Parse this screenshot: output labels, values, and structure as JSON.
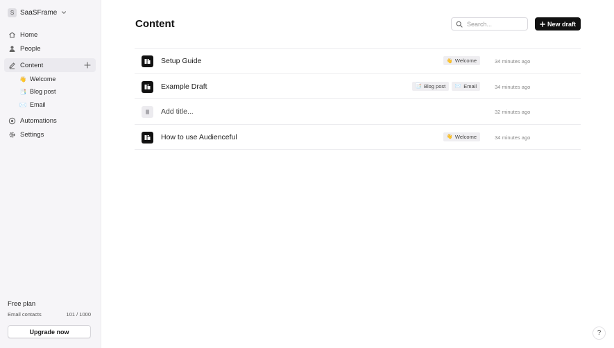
{
  "workspace": {
    "avatar_letter": "S",
    "name": "SaaSFrame"
  },
  "nav": {
    "home": "Home",
    "people": "People",
    "content": "Content",
    "automations": "Automations",
    "settings": "Settings"
  },
  "content_sub": [
    {
      "emoji": "👋",
      "label": "Welcome"
    },
    {
      "emoji": "📑",
      "label": "Blog post"
    },
    {
      "emoji": "✉️",
      "label": "Email"
    }
  ],
  "plan": {
    "title": "Free plan",
    "contacts_label": "Email contacts",
    "contacts_value": "101 / 1000",
    "upgrade_label": "Upgrade now"
  },
  "main": {
    "title": "Content",
    "search_placeholder": "Search...",
    "new_draft_label": "New draft"
  },
  "rows": [
    {
      "title": "Setup Guide",
      "tags": [
        {
          "emoji": "👋",
          "label": "Welcome"
        }
      ],
      "time": "34 minutes ago"
    },
    {
      "title": "Example Draft",
      "tags": [
        {
          "emoji": "📑",
          "label": "Blog post"
        },
        {
          "emoji": "✉️",
          "label": "Email"
        }
      ],
      "time": "34 minutes ago"
    },
    {
      "title": "Add title...",
      "tags": [],
      "time": "32 minutes ago"
    },
    {
      "title": "How to use Audienceful",
      "tags": [
        {
          "emoji": "👋",
          "label": "Welcome"
        }
      ],
      "time": "34 minutes ago"
    }
  ],
  "help_label": "?",
  "colors": {
    "accent": "#111111",
    "sidebar_bg": "#f6f5f8",
    "active_bg": "#ebeaef",
    "tag_bg": "#efeef1"
  }
}
